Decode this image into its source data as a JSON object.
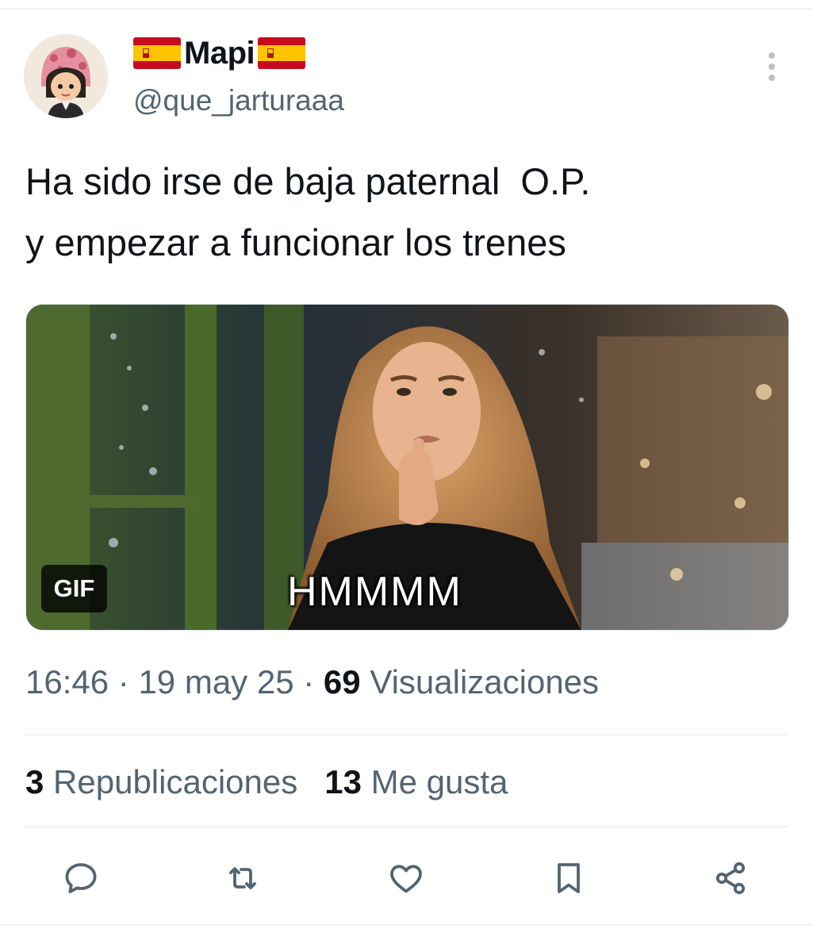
{
  "tweet": {
    "author": {
      "name": "Mapi",
      "handle": "@que_jarturaaa",
      "flag_icon": "spain-flag-icon"
    },
    "text": "Ha sido irse de baja paternal  O.P.\ny empezar a funcionar los trenes",
    "media": {
      "badge": "GIF",
      "caption": "HMMMM"
    },
    "time": "16:46",
    "date": "19 may 25",
    "views_count": "69",
    "views_label": "Visualizaciones",
    "reposts_count": "3",
    "reposts_label": "Republicaciones",
    "likes_count": "13",
    "likes_label": "Me gusta",
    "separator": "·"
  },
  "actions": [
    {
      "name": "reply",
      "icon": "reply-icon"
    },
    {
      "name": "repost",
      "icon": "repost-icon"
    },
    {
      "name": "like",
      "icon": "heart-icon"
    },
    {
      "name": "bookmark",
      "icon": "bookmark-icon"
    },
    {
      "name": "share",
      "icon": "share-icon"
    }
  ],
  "colors": {
    "text_primary": "#0f1419",
    "text_secondary": "#536471",
    "divider": "#eff3f4",
    "flag_red": "#c60b1e",
    "flag_yellow": "#ffc400"
  }
}
